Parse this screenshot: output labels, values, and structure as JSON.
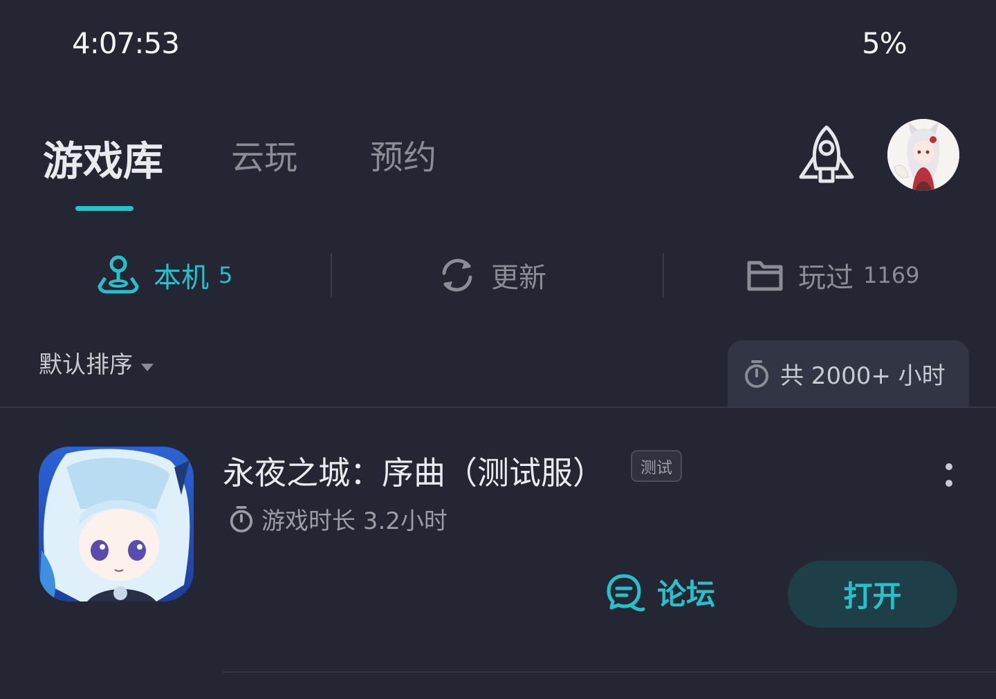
{
  "status_bar": {
    "time": "4:07:53",
    "battery": "5%"
  },
  "header": {
    "tabs": [
      {
        "label": "游戏库",
        "active": true
      },
      {
        "label": "云玩",
        "active": false
      },
      {
        "label": "预约",
        "active": false
      }
    ],
    "rocket_icon": "rocket-icon",
    "avatar_icon": "user-avatar"
  },
  "filters": [
    {
      "label": "本机",
      "count": "5",
      "icon": "joystick-icon",
      "active": true
    },
    {
      "label": "更新",
      "count": "",
      "icon": "refresh-icon",
      "active": false
    },
    {
      "label": "玩过",
      "count": "1169",
      "icon": "folder-icon",
      "active": false
    }
  ],
  "sort": {
    "label": "默认排序"
  },
  "total": {
    "label": "共 2000+ 小时",
    "icon": "stopwatch-icon"
  },
  "games": [
    {
      "title": "永夜之城：序曲（测试服）",
      "tag": "测试",
      "playtime": "游戏时长 3.2小时",
      "forum_label": "论坛",
      "open_label": "打开"
    }
  ],
  "colors": {
    "accent": "#25c2cc",
    "background": "#242733",
    "muted": "#8a8d96",
    "panel": "#323644"
  }
}
